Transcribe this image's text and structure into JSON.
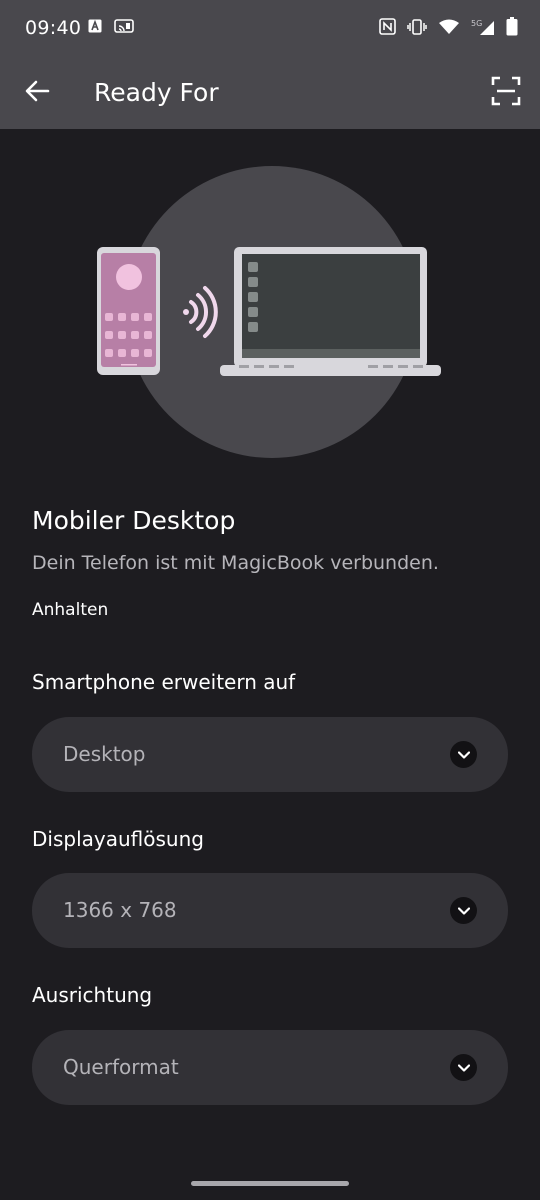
{
  "status_bar": {
    "time": "09:40",
    "left_icons": [
      "a-box-icon",
      "cast-icon"
    ],
    "right_icons": [
      "nfc-icon",
      "vibrate-icon",
      "wifi-icon",
      "signal-5g-icon",
      "battery-icon"
    ],
    "network_label": "5G"
  },
  "app_bar": {
    "title": "Ready For",
    "back_icon": "arrow-back-icon",
    "scan_icon": "scan-frame-icon"
  },
  "hero": {
    "illustration": "phone-to-laptop-connection"
  },
  "connection": {
    "title": "Mobiler Desktop",
    "subtitle": "Dein Telefon ist mit MagicBook verbunden.",
    "action": "Anhalten"
  },
  "settings": [
    {
      "label": "Smartphone erweitern auf",
      "value": "Desktop"
    },
    {
      "label": "Displayauflösung",
      "value": "1366 x 768"
    },
    {
      "label": "Ausrichtung",
      "value": "Querformat"
    }
  ],
  "colors": {
    "background": "#1d1c20",
    "app_bar": "#49484d",
    "select_bg": "#323136",
    "phone_accent": "#b77fa6"
  }
}
